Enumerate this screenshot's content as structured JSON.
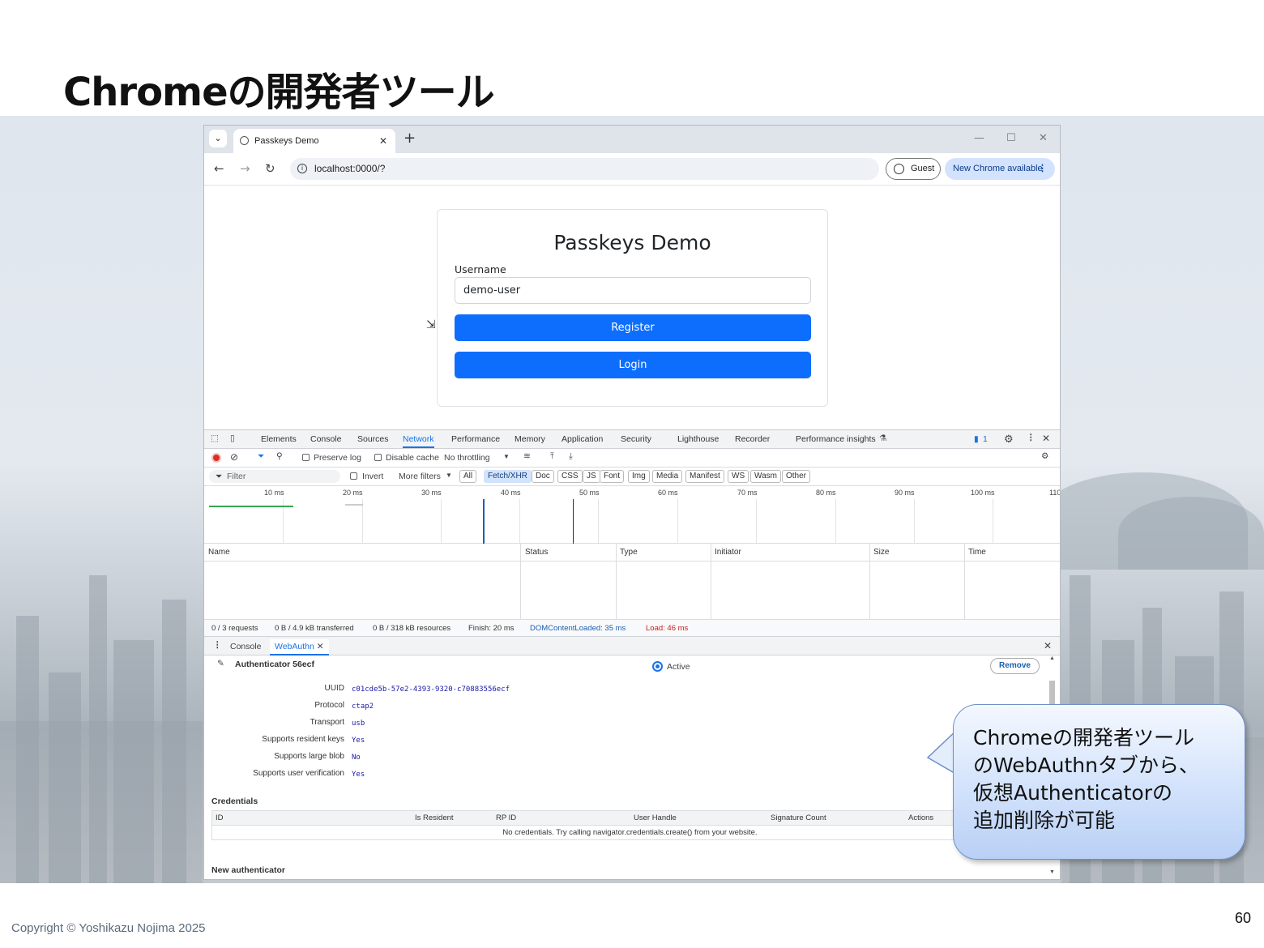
{
  "slide": {
    "title": "Chromeの開発者ツール",
    "copyright": "Copyright © Yoshikazu Nojima 2025",
    "page_number": "60"
  },
  "browser": {
    "tab_title": "Passkeys Demo",
    "new_tab": "+",
    "url": "localhost:0000/?",
    "guest_label": "Guest",
    "update_label": "New Chrome available"
  },
  "page": {
    "heading": "Passkeys Demo",
    "username_label": "Username",
    "username_value": "demo-user",
    "register_label": "Register",
    "login_label": "Login"
  },
  "devtools": {
    "tabs": [
      "Elements",
      "Console",
      "Sources",
      "Network",
      "Performance",
      "Memory",
      "Application",
      "Security",
      "Lighthouse",
      "Recorder",
      "Performance insights"
    ],
    "active_tab": "Network",
    "issues_count": "1",
    "toolbar": {
      "preserve_log": "Preserve log",
      "disable_cache": "Disable cache",
      "throttling": "No throttling"
    },
    "filter": {
      "placeholder": "Filter",
      "invert": "Invert",
      "more_filters": "More filters",
      "types": [
        "All",
        "Fetch/XHR",
        "Doc",
        "CSS",
        "JS",
        "Font",
        "Img",
        "Media",
        "Manifest",
        "WS",
        "Wasm",
        "Other"
      ],
      "selected_type": "Fetch/XHR"
    },
    "timeline_ticks": [
      "10 ms",
      "20 ms",
      "30 ms",
      "40 ms",
      "50 ms",
      "60 ms",
      "70 ms",
      "80 ms",
      "90 ms",
      "100 ms",
      "110"
    ],
    "columns": [
      "Name",
      "Status",
      "Type",
      "Initiator",
      "Size",
      "Time"
    ],
    "status": {
      "requests": "0 / 3 requests",
      "transferred": "0 B / 4.9 kB transferred",
      "resources": "0 B / 318 kB resources",
      "finish": "Finish: 20 ms",
      "dom_loaded": "DOMContentLoaded: 35 ms",
      "load": "Load: 46 ms"
    },
    "drawer": {
      "tabs": [
        "Console",
        "WebAuthn"
      ],
      "active_tab": "WebAuthn",
      "authenticator_title": "Authenticator 56ecf",
      "active_label": "Active",
      "remove_label": "Remove",
      "properties": [
        {
          "key": "UUID",
          "value": "c01cde5b-57e2-4393-9320-c70883556ecf"
        },
        {
          "key": "Protocol",
          "value": "ctap2"
        },
        {
          "key": "Transport",
          "value": "usb"
        },
        {
          "key": "Supports resident keys",
          "value": "Yes"
        },
        {
          "key": "Supports large blob",
          "value": "No"
        },
        {
          "key": "Supports user verification",
          "value": "Yes"
        }
      ],
      "credentials_heading": "Credentials",
      "credentials_columns": [
        "ID",
        "Is Resident",
        "RP ID",
        "User Handle",
        "Signature Count",
        "Actions"
      ],
      "credentials_empty": "No credentials. Try calling navigator.credentials.create() from your website.",
      "new_authenticator_heading": "New authenticator"
    }
  },
  "callout": {
    "text": "Chromeの開発者ツール\nのWebAuthnタブから、\n仮想Authenticatorの\n追加削除が可能"
  }
}
